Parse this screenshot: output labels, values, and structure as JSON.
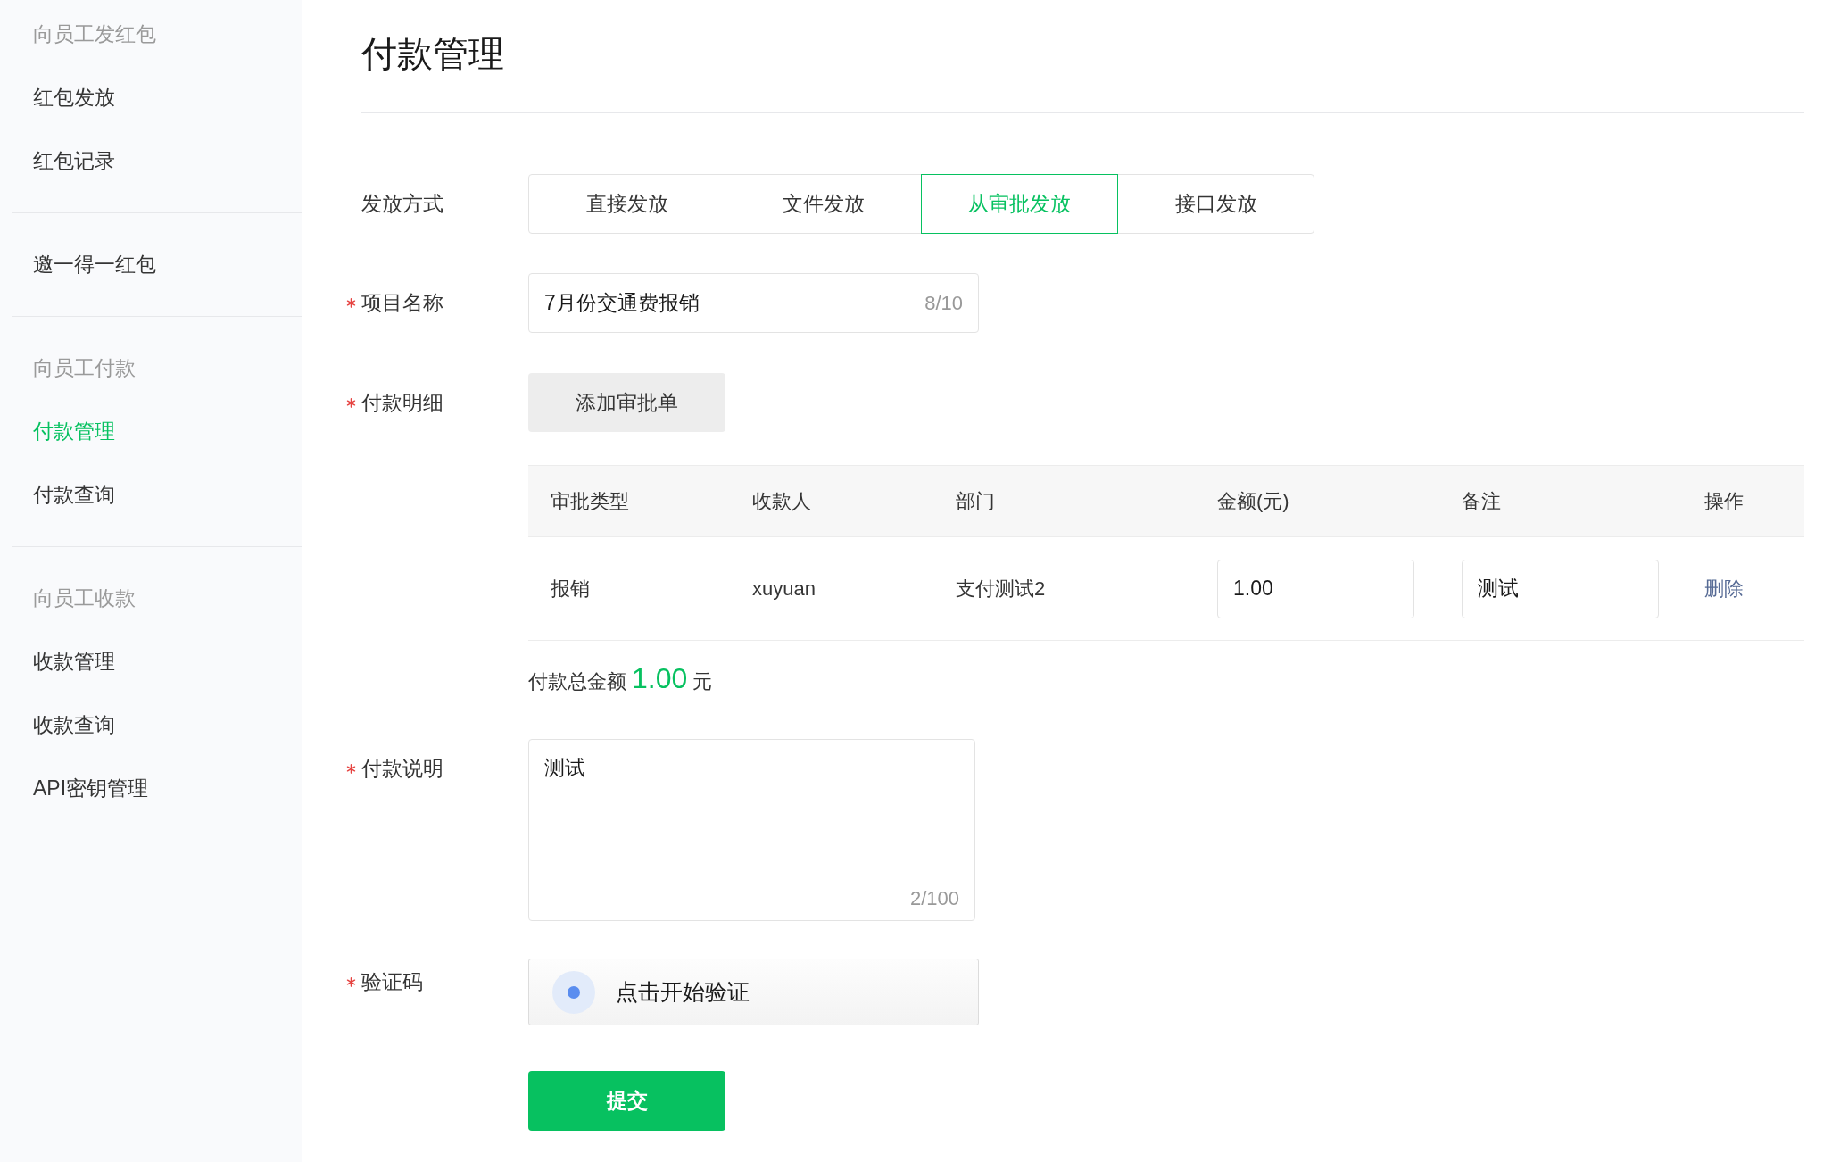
{
  "sidebar": {
    "groups": [
      {
        "title": "向员工发红包",
        "items": [
          {
            "label": "红包发放",
            "selected": false
          },
          {
            "label": "红包记录",
            "selected": false
          }
        ]
      },
      {
        "items": [
          {
            "label": "邀一得一红包",
            "selected": false
          }
        ]
      },
      {
        "title": "向员工付款",
        "items": [
          {
            "label": "付款管理",
            "selected": true
          },
          {
            "label": "付款查询",
            "selected": false
          }
        ]
      },
      {
        "title": "向员工收款",
        "items": [
          {
            "label": "收款管理",
            "selected": false
          },
          {
            "label": "收款查询",
            "selected": false
          },
          {
            "label": "API密钥管理",
            "selected": false
          }
        ]
      }
    ]
  },
  "page_title": "付款管理",
  "form": [
    {
      "kind": "tabs",
      "label": "发放方式",
      "required": false,
      "tabs": [
        {
          "label": "直接发放",
          "selected": false
        },
        {
          "label": "文件发放",
          "selected": false
        },
        {
          "label": "从审批发放",
          "selected": true
        },
        {
          "label": "接口发放",
          "selected": false
        }
      ]
    },
    {
      "kind": "text",
      "label": "项目名称",
      "required": true,
      "value": "7月份交通费报销",
      "counter": "8/10"
    },
    {
      "kind": "button",
      "label": "付款明细",
      "required": true,
      "button": "添加审批单"
    },
    {
      "kind": "table",
      "columns": [
        "审批类型",
        "收款人",
        "部门",
        "金额(元)",
        "备注",
        "操作"
      ],
      "rows": [
        {
          "type": "报销",
          "payee": "xuyuan",
          "department": "支付测试2",
          "amount": "1.00",
          "remark": "测试",
          "action": "删除"
        }
      ]
    },
    {
      "kind": "total",
      "label": "付款总金额",
      "amount": "1.00",
      "unit": "元"
    },
    {
      "kind": "textarea",
      "label": "付款说明",
      "required": true,
      "value": "测试",
      "counter": "2/100"
    },
    {
      "kind": "captcha",
      "label": "验证码",
      "required": true,
      "button": "点击开始验证"
    },
    {
      "kind": "submit",
      "button": "提交"
    }
  ]
}
